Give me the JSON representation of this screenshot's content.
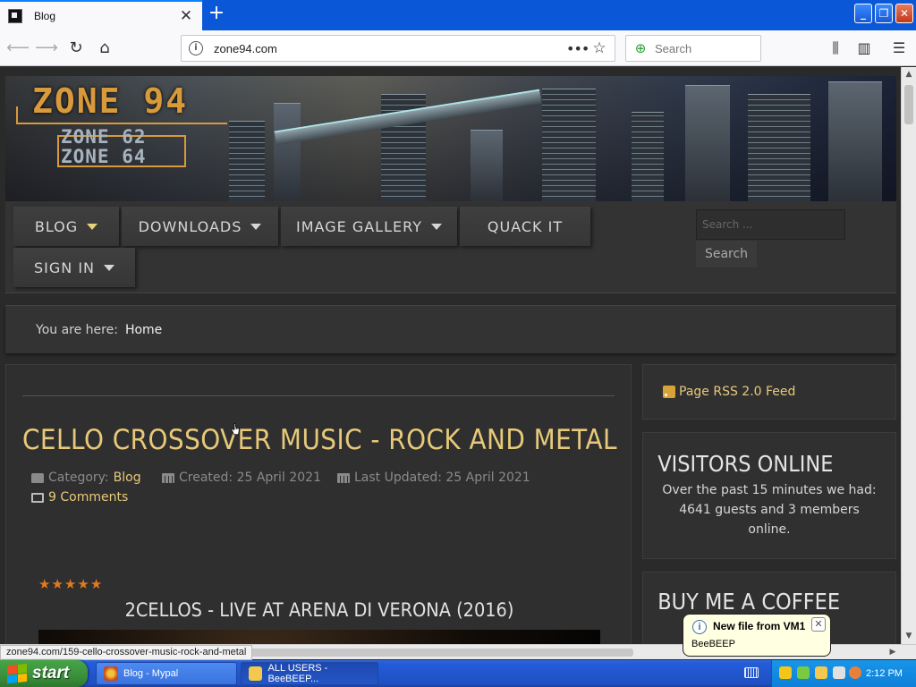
{
  "browser": {
    "tab_title": "Blog",
    "url": "zone94.com",
    "search_placeholder": "Search"
  },
  "site": {
    "logo_main": "ZONE 94",
    "logo_sub1": "ZONE 62",
    "logo_sub2": "ZONE 64",
    "menu": [
      {
        "label": "BLOG",
        "has_caret": true,
        "active": true
      },
      {
        "label": "DOWNLOADS",
        "has_caret": true
      },
      {
        "label": "IMAGE GALLERY",
        "has_caret": true
      },
      {
        "label": "QUACK IT",
        "has_caret": false
      },
      {
        "label": "SIGN IN",
        "has_caret": true
      }
    ],
    "search_placeholder": "Search ...",
    "search_button": "Search",
    "breadcrumb_label": "You are here:",
    "breadcrumb_home": "Home"
  },
  "article": {
    "title": "CELLO CROSSOVER MUSIC - ROCK AND METAL",
    "category_label": "Category:",
    "category": "Blog",
    "created": "Created: 25 April 2021",
    "updated": "Last Updated: 25 April 2021",
    "comments": "9 Comments",
    "rating_stars": 5,
    "video_title": "2CELLOS - LIVE AT ARENA DI VERONA (2016)"
  },
  "sidebar": {
    "rss": "Page RSS 2.0 Feed",
    "visitors_title": "VISITORS ONLINE",
    "visitors_text": "Over the past 15 minutes we had: 4641 guests and 3 members online.",
    "coffee_title": "BUY ME A COFFEE"
  },
  "status_bar_url": "zone94.com/159-cello-crossover-music-rock-and-metal",
  "notification": {
    "title": "New file from VM1",
    "text": "BeeBEEP"
  },
  "taskbar": {
    "start_label": "start",
    "tasks": [
      {
        "label": "Blog - Mypal",
        "active": false
      },
      {
        "label": "ALL USERS - BeeBEEP...",
        "active": true
      }
    ],
    "clock": "2:12 PM"
  },
  "colors": {
    "accent_gold": "#e8c97a",
    "menu_caret_active": "#e8d27a",
    "star_orange": "#e07a1f"
  }
}
